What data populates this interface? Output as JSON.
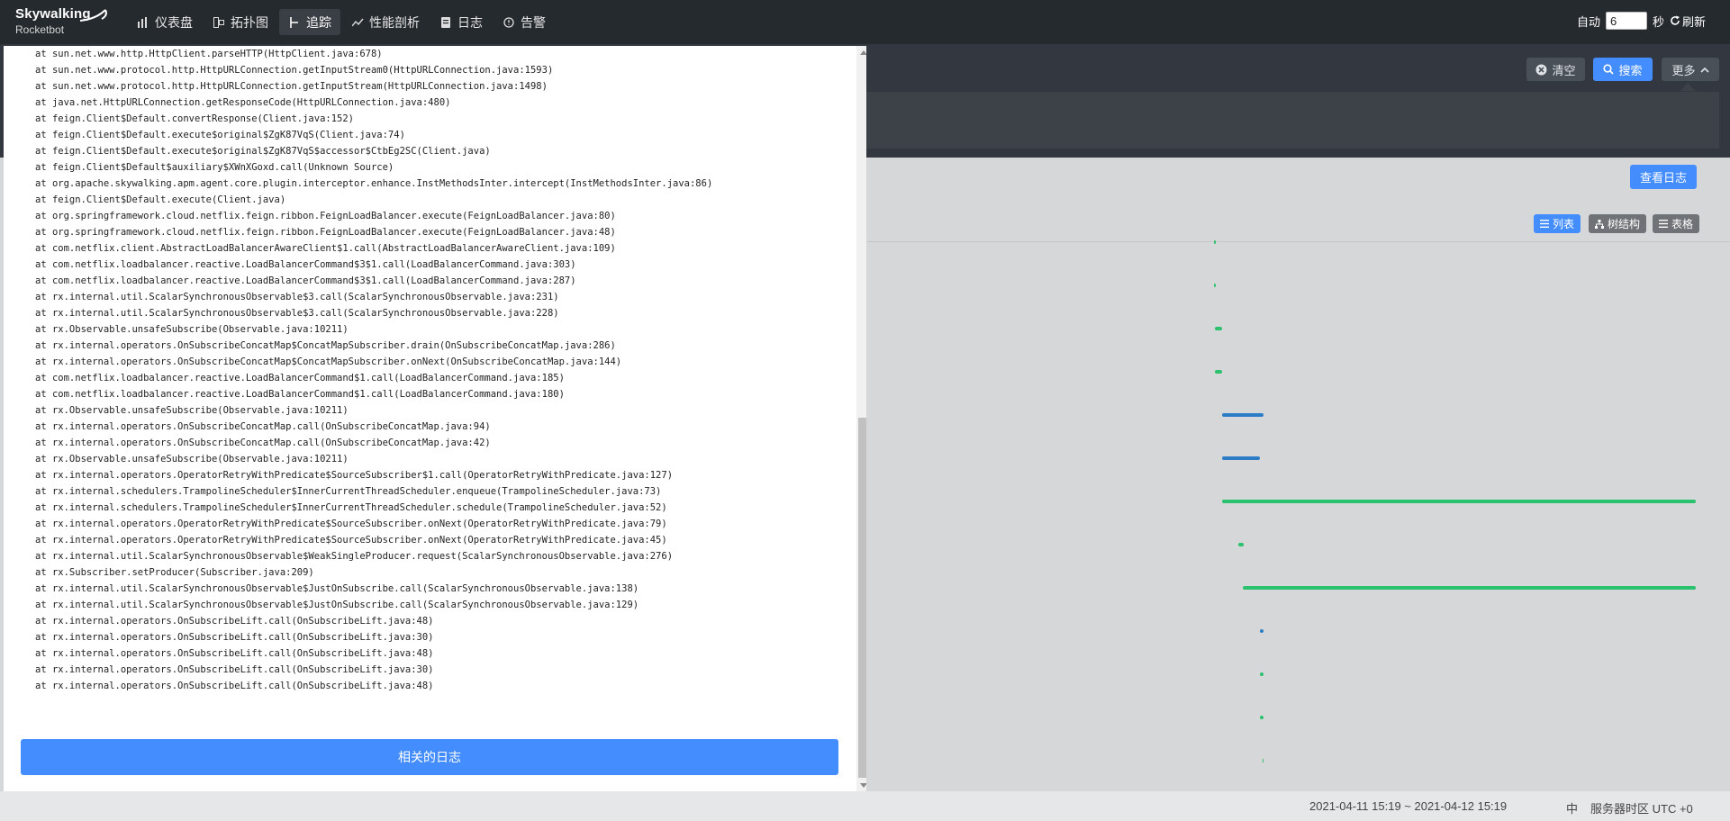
{
  "app": {
    "logo_main": "Skywalking",
    "logo_sub": "Rocketbot"
  },
  "nav": [
    {
      "label": "仪表盘",
      "icon": "dashboard-icon"
    },
    {
      "label": "拓扑图",
      "icon": "topology-icon"
    },
    {
      "label": "追踪",
      "icon": "trace-icon",
      "active": true
    },
    {
      "label": "性能剖析",
      "icon": "profile-icon"
    },
    {
      "label": "日志",
      "icon": "log-icon"
    },
    {
      "label": "告警",
      "icon": "alarm-icon"
    }
  ],
  "topright": {
    "auto_label": "自动",
    "interval_value": "6",
    "seconds_label": "秒",
    "refresh_label": "刷新"
  },
  "toolbar": {
    "clear_label": "清空",
    "search_label": "搜索",
    "more_label": "更多"
  },
  "trace": {
    "view_logs_label": "查看日志",
    "view_list_label": "列表",
    "view_tree_label": "树结构",
    "view_table_label": "表格"
  },
  "modal": {
    "stack_lines": [
      "at sun.net.www.http.HttpClient.parseHTTP(HttpClient.java:678)",
      "at sun.net.www.protocol.http.HttpURLConnection.getInputStream0(HttpURLConnection.java:1593)",
      "at sun.net.www.protocol.http.HttpURLConnection.getInputStream(HttpURLConnection.java:1498)",
      "at java.net.HttpURLConnection.getResponseCode(HttpURLConnection.java:480)",
      "at feign.Client$Default.convertResponse(Client.java:152)",
      "at feign.Client$Default.execute$original$ZgK87VqS(Client.java:74)",
      "at feign.Client$Default.execute$original$ZgK87VqS$accessor$CtbEg2SC(Client.java)",
      "at feign.Client$Default$auxiliary$XWnXGoxd.call(Unknown Source)",
      "at org.apache.skywalking.apm.agent.core.plugin.interceptor.enhance.InstMethodsInter.intercept(InstMethodsInter.java:86)",
      "at feign.Client$Default.execute(Client.java)",
      "at org.springframework.cloud.netflix.feign.ribbon.FeignLoadBalancer.execute(FeignLoadBalancer.java:80)",
      "at org.springframework.cloud.netflix.feign.ribbon.FeignLoadBalancer.execute(FeignLoadBalancer.java:48)",
      "at com.netflix.client.AbstractLoadBalancerAwareClient$1.call(AbstractLoadBalancerAwareClient.java:109)",
      "at com.netflix.loadbalancer.reactive.LoadBalancerCommand$3$1.call(LoadBalancerCommand.java:303)",
      "at com.netflix.loadbalancer.reactive.LoadBalancerCommand$3$1.call(LoadBalancerCommand.java:287)",
      "at rx.internal.util.ScalarSynchronousObservable$3.call(ScalarSynchronousObservable.java:231)",
      "at rx.internal.util.ScalarSynchronousObservable$3.call(ScalarSynchronousObservable.java:228)",
      "at rx.Observable.unsafeSubscribe(Observable.java:10211)",
      "at rx.internal.operators.OnSubscribeConcatMap$ConcatMapSubscriber.drain(OnSubscribeConcatMap.java:286)",
      "at rx.internal.operators.OnSubscribeConcatMap$ConcatMapSubscriber.onNext(OnSubscribeConcatMap.java:144)",
      "at com.netflix.loadbalancer.reactive.LoadBalancerCommand$1.call(LoadBalancerCommand.java:185)",
      "at com.netflix.loadbalancer.reactive.LoadBalancerCommand$1.call(LoadBalancerCommand.java:180)",
      "at rx.Observable.unsafeSubscribe(Observable.java:10211)",
      "at rx.internal.operators.OnSubscribeConcatMap.call(OnSubscribeConcatMap.java:94)",
      "at rx.internal.operators.OnSubscribeConcatMap.call(OnSubscribeConcatMap.java:42)",
      "at rx.Observable.unsafeSubscribe(Observable.java:10211)",
      "at rx.internal.operators.OperatorRetryWithPredicate$SourceSubscriber$1.call(OperatorRetryWithPredicate.java:127)",
      "at rx.internal.schedulers.TrampolineScheduler$InnerCurrentThreadScheduler.enqueue(TrampolineScheduler.java:73)",
      "at rx.internal.schedulers.TrampolineScheduler$InnerCurrentThreadScheduler.schedule(TrampolineScheduler.java:52)",
      "at rx.internal.operators.OperatorRetryWithPredicate$SourceSubscriber.onNext(OperatorRetryWithPredicate.java:79)",
      "at rx.internal.operators.OperatorRetryWithPredicate$SourceSubscriber.onNext(OperatorRetryWithPredicate.java:45)",
      "at rx.internal.util.ScalarSynchronousObservable$WeakSingleProducer.request(ScalarSynchronousObservable.java:276)",
      "at rx.Subscriber.setProducer(Subscriber.java:209)",
      "at rx.internal.util.ScalarSynchronousObservable$JustOnSubscribe.call(ScalarSynchronousObservable.java:138)",
      "at rx.internal.util.ScalarSynchronousObservable$JustOnSubscribe.call(ScalarSynchronousObservable.java:129)",
      "at rx.internal.operators.OnSubscribeLift.call(OnSubscribeLift.java:48)",
      "at rx.internal.operators.OnSubscribeLift.call(OnSubscribeLift.java:30)",
      "at rx.internal.operators.OnSubscribeLift.call(OnSubscribeLift.java:48)",
      "at rx.internal.operators.OnSubscribeLift.call(OnSubscribeLift.java:30)",
      "at rx.internal.operators.OnSubscribeLift.call(OnSubscribeLift.java:48)"
    ],
    "related_logs_label": "相关的日志"
  },
  "status": {
    "time_range": "2021-04-11 15:19 ~ 2021-04-12 15:19",
    "lang": "中",
    "timezone": "服务器时区 UTC +0"
  },
  "colors": {
    "primary": "#448dfe",
    "nav_bg": "#252a2f",
    "span_blue": "#2d7cc7",
    "span_green": "#2bc26f"
  }
}
